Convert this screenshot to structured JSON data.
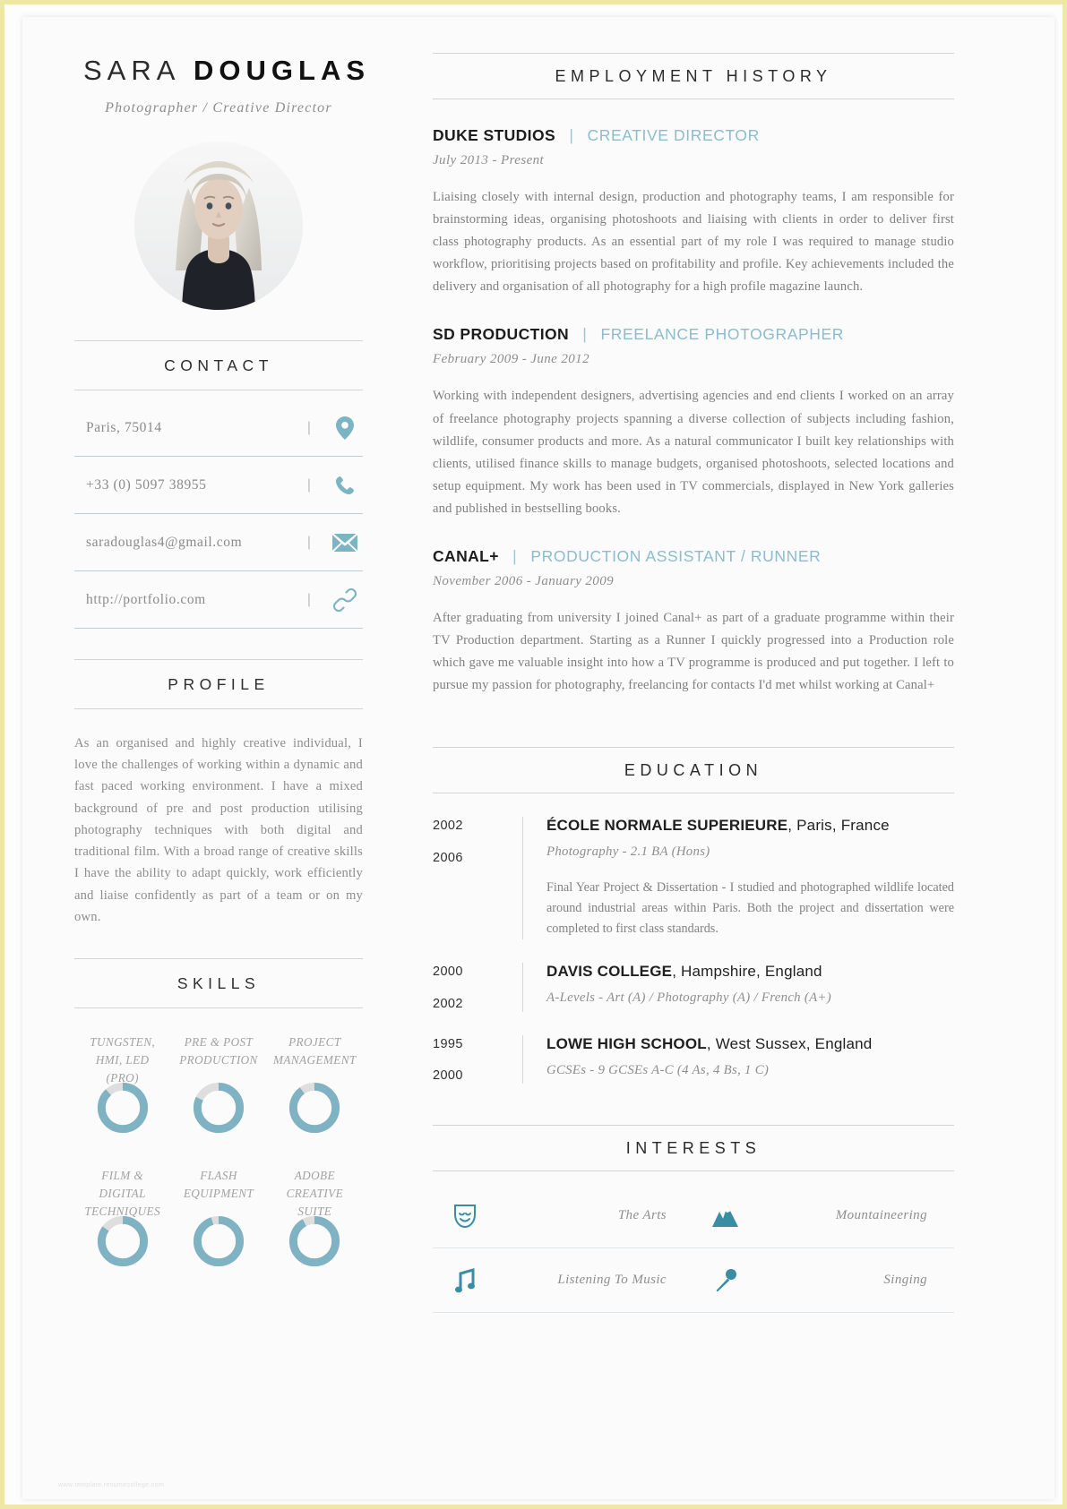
{
  "colors": {
    "accent": "#7cb4c4",
    "accent_dark": "#3a8ea3",
    "ring_fill": "#7fb2c2",
    "ring_track": "#dedede",
    "text_dark": "#1d1d1d",
    "text_muted": "#8d8d8d",
    "page_border": "#efe7a8"
  },
  "header": {
    "first_name": "SARA",
    "last_name": "DOUGLAS",
    "subtitle": "Photographer / Creative Director",
    "photo_alt": "portrait-photo"
  },
  "contact": {
    "heading": "CONTACT",
    "items": [
      {
        "value": "Paris, 75014",
        "icon": "location-pin-icon",
        "divider": "|"
      },
      {
        "value": "+33 (0) 5097 38955",
        "icon": "phone-icon",
        "divider": "|"
      },
      {
        "value": "saradouglas4@gmail.com",
        "icon": "envelope-icon",
        "divider": "|"
      },
      {
        "value": "http://portfolio.com",
        "icon": "link-icon",
        "divider": "|"
      }
    ]
  },
  "profile": {
    "heading": "PROFILE",
    "text": "As an organised and highly creative individual, I love the challenges of working within a dynamic and fast paced working environment. I have a mixed background of pre and post production utilising photography techniques with both digital and traditional film. With a broad range of creative skills I have the ability to adapt quickly, work efficiently and liaise confidently as part of a team or on my own."
  },
  "skills": {
    "heading": "SKILLS",
    "items": [
      {
        "label": "TUNGSTEN, HMI, LED (PRO)",
        "percent": 88
      },
      {
        "label": "PRE & POST PRODUCTION",
        "percent": 82
      },
      {
        "label": "PROJECT MANAGEMENT",
        "percent": 90
      },
      {
        "label": "FILM & DIGITAL TECHNIQUES",
        "percent": 85
      },
      {
        "label": "FLASH EQUIPMENT",
        "percent": 95
      },
      {
        "label": "ADOBE CREATIVE SUITE",
        "percent": 92
      }
    ]
  },
  "employment": {
    "heading": "EMPLOYMENT HISTORY",
    "jobs": [
      {
        "company": "DUKE STUDIOS",
        "separator": "|",
        "role": "CREATIVE DIRECTOR",
        "dates": "July 2013 - Present",
        "description": "Liaising closely with internal design, production and photography teams, I am responsible for brainstorming ideas, organising photoshoots and liaising with clients in order to deliver first class photography products.  As an essential part of my role I was required to manage studio workflow, prioritising projects based on profitability and profile.  Key achievements included the delivery and organisation of all photography for a high profile magazine launch."
      },
      {
        "company": "SD PRODUCTION",
        "separator": "|",
        "role": "FREELANCE PHOTOGRAPHER",
        "dates": "February 2009 - June 2012",
        "description": "Working with independent designers, advertising agencies and end clients I worked on an array of freelance photography projects spanning a diverse collection of subjects including fashion, wildlife, consumer products and more. As a natural communicator I built key relationships with clients, utilised finance skills to manage budgets, organised photoshoots, selected locations and setup equipment.   My work has been used in TV commercials, displayed in New York galleries and published in bestselling books."
      },
      {
        "company": "CANAL+",
        "separator": "|",
        "role": "PRODUCTION ASSISTANT / RUNNER",
        "dates": "November 2006 - January 2009",
        "description": "After graduating from university I joined Canal+ as part of a graduate programme within their TV Production department.  Starting as a Runner I quickly progressed into a Production role which gave me valuable insight into how a TV programme is produced and put together. I left to pursue my passion for photography, freelancing for contacts I'd met whilst working at Canal+"
      }
    ]
  },
  "education": {
    "heading": "EDUCATION",
    "items": [
      {
        "start_year": "2002",
        "end_year": "2006",
        "school_name": "ÉCOLE NORMALE SUPERIEURE",
        "school_location": ", Paris, France",
        "course": "Photography - 2.1 BA (Hons)",
        "note": "Final Year Project & Dissertation - I studied and photographed wildlife located around industrial areas within Paris. Both the project and dissertation were completed to first class standards."
      },
      {
        "start_year": "2000",
        "end_year": "2002",
        "school_name": "DAVIS COLLEGE",
        "school_location": ", Hampshire, England",
        "course": "A-Levels - Art (A) / Photography (A) / French (A+)",
        "note": ""
      },
      {
        "start_year": "1995",
        "end_year": "2000",
        "school_name": "LOWE HIGH SCHOOL",
        "school_location": ", West Sussex, England",
        "course": "GCSEs - 9 GCSEs A-C (4 As, 4 Bs, 1 C)",
        "note": ""
      }
    ]
  },
  "interests": {
    "heading": "INTERESTS",
    "items": [
      {
        "label": "The Arts",
        "icon": "theatre-mask-icon"
      },
      {
        "label": "Mountaineering",
        "icon": "mountains-icon"
      },
      {
        "label": "Listening To Music",
        "icon": "music-note-icon"
      },
      {
        "label": "Singing",
        "icon": "microphone-icon"
      }
    ]
  },
  "watermark": "www.template.resumecollege.com"
}
